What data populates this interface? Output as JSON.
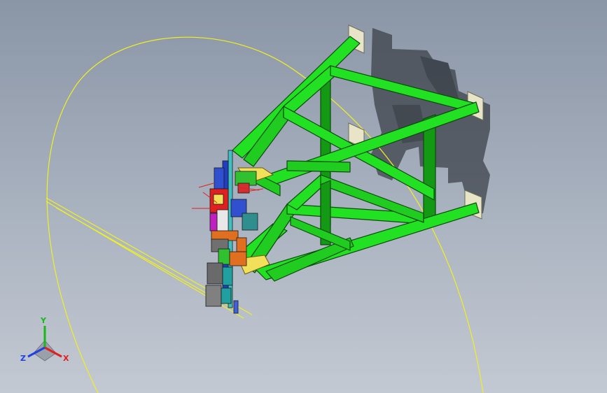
{
  "viewport": {
    "colors": {
      "bg_top": "#8a95a6",
      "bg_bottom": "#c3c9d2",
      "frame_green": "#22e022",
      "frame_green_dark": "#139913",
      "frame_outline": "#0b4a0b",
      "wire_yellow": "#f0f020",
      "shadow": "#3a3f46",
      "plate": "#e8e4c8",
      "part_yellow": "#f2e05a"
    }
  },
  "triad": {
    "x_label": "X",
    "y_label": "Y",
    "z_label": "Z",
    "x_color": "#e02020",
    "y_color": "#18b818",
    "z_color": "#2040e0"
  }
}
